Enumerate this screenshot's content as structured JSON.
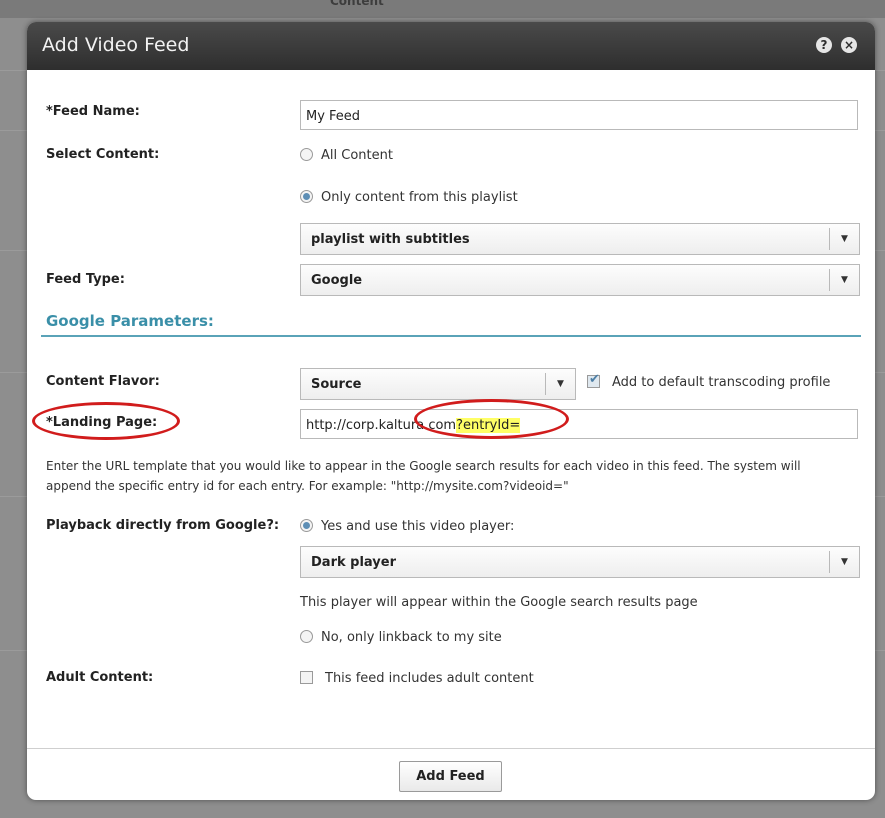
{
  "background": {
    "label": "Content"
  },
  "dialog": {
    "title": "Add Video Feed",
    "help_icon": "?",
    "close_icon": "×"
  },
  "form": {
    "feed_name": {
      "label": "*Feed Name:",
      "value": "My Feed"
    },
    "select_content": {
      "label": "Select Content:",
      "option_all": "All Content",
      "option_playlist": "Only content from this playlist",
      "selected": "option_playlist",
      "playlist_value": "playlist with subtitles"
    },
    "feed_type": {
      "label": "Feed Type:",
      "value": "Google"
    }
  },
  "google": {
    "section_title": "Google Parameters:",
    "content_flavor": {
      "label": "Content Flavor:",
      "value": "Source",
      "checkbox_label": "Add to default transcoding profile",
      "checked": true
    },
    "landing_page": {
      "label": "*Landing Page:",
      "value_prefix": "http://corp.kaltura.com",
      "value_highlight": "?entryId="
    },
    "help_text": "Enter the URL template that you would like to appear in the Google search results for each video in this feed.  The system will append the specific entry id for each entry. For example: \"http://mysite.com?videoid=\"",
    "playback": {
      "label": "Playback directly from Google?:",
      "option_yes": "Yes and use this video player:",
      "player_value": "Dark player",
      "player_note": "This player will appear within the Google search results page",
      "option_no": "No, only linkback to my site",
      "selected": "option_yes"
    },
    "adult": {
      "label": "Adult Content:",
      "checkbox_label": "This feed includes adult content",
      "checked": false
    }
  },
  "footer": {
    "add_button": "Add Feed"
  },
  "colors": {
    "title_bar": "#3a3a3a",
    "section_accent": "#3a8fa8",
    "annotation": "#d11c1c",
    "highlight": "#ffff66"
  }
}
